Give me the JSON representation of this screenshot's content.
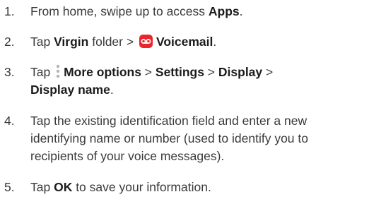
{
  "steps": [
    {
      "number": "1.",
      "pre": "From home, swipe up to access ",
      "apps": "Apps",
      "post": "."
    },
    {
      "number": "2.",
      "tap": "Tap ",
      "folder_name": "Virgin",
      "folder_word": " folder",
      "sep": " > ",
      "icon": "voicemail-app-icon",
      "voicemail": "Voicemail",
      "post": "."
    },
    {
      "number": "3.",
      "tap": "Tap ",
      "icon": "more-options-icon",
      "more_options": "More options",
      "sep1": " > ",
      "settings": "Settings",
      "sep2": " > ",
      "display": "Display",
      "sep3": " >",
      "display_name": "Display name",
      "post": "."
    },
    {
      "number": "4.",
      "line1": "Tap the existing identification field and enter a new",
      "line2": "identifying name or number (used to identify you to",
      "line3": "recipients of your voice messages)."
    },
    {
      "number": "5.",
      "tap": "Tap ",
      "ok": "OK",
      "post": " to save your information."
    }
  ],
  "colors": {
    "text": "#3a3a3a",
    "bold_text": "#1c1c1c",
    "voicemail_icon_bg": "#e8262b",
    "more_icon_dots": "#b5b5b5"
  }
}
